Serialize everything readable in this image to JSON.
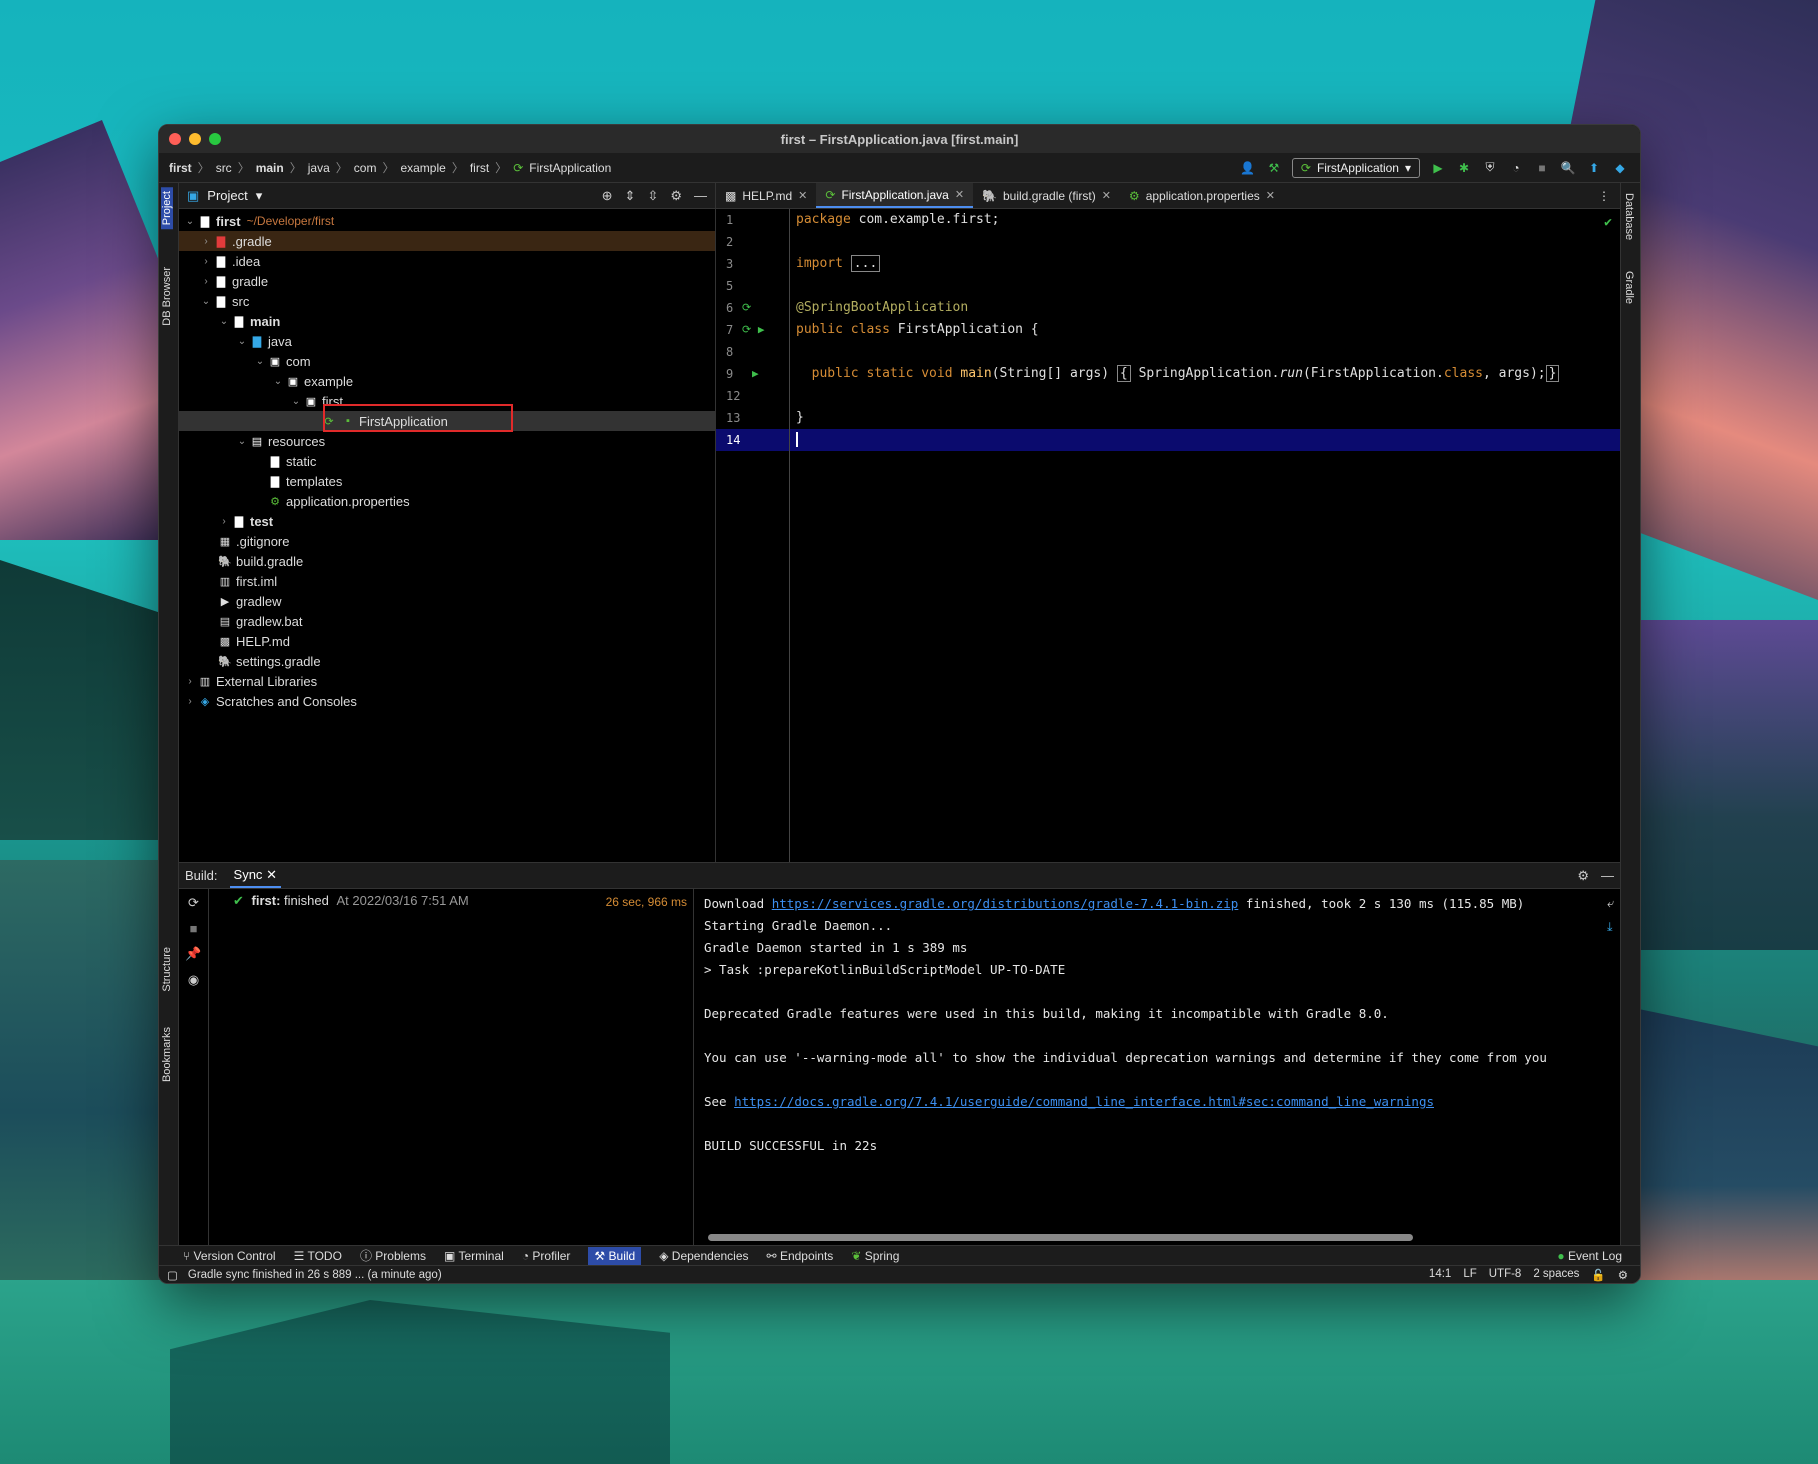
{
  "window": {
    "title": "first – FirstApplication.java [first.main]"
  },
  "breadcrumbs": [
    "first",
    "src",
    "main",
    "java",
    "com",
    "example",
    "first",
    "FirstApplication"
  ],
  "run_config": {
    "label": "FirstApplication"
  },
  "left_bar": {
    "project": "Project",
    "db_browser": "DB Browser",
    "structure": "Structure",
    "bookmarks": "Bookmarks"
  },
  "right_bar": {
    "database": "Database",
    "gradle": "Gradle"
  },
  "project_panel": {
    "title": "Project",
    "tree": [
      {
        "label": "first",
        "extra": "~/Developer/first"
      },
      {
        "label": ".gradle"
      },
      {
        "label": ".idea"
      },
      {
        "label": "gradle"
      },
      {
        "label": "src"
      },
      {
        "label": "main"
      },
      {
        "label": "java"
      },
      {
        "label": "com"
      },
      {
        "label": "example"
      },
      {
        "label": "first"
      },
      {
        "label": "FirstApplication"
      },
      {
        "label": "resources"
      },
      {
        "label": "static"
      },
      {
        "label": "templates"
      },
      {
        "label": "application.properties"
      },
      {
        "label": "test"
      },
      {
        "label": ".gitignore"
      },
      {
        "label": "build.gradle"
      },
      {
        "label": "first.iml"
      },
      {
        "label": "gradlew"
      },
      {
        "label": "gradlew.bat"
      },
      {
        "label": "HELP.md"
      },
      {
        "label": "settings.gradle"
      },
      {
        "label": "External Libraries"
      },
      {
        "label": "Scratches and Consoles"
      }
    ]
  },
  "editor": {
    "tabs": [
      "HELP.md",
      "FirstApplication.java",
      "build.gradle (first)",
      "application.properties"
    ],
    "line_numbers": [
      "1",
      "2",
      "3",
      "5",
      "6",
      "7",
      "8",
      "9",
      "12",
      "13",
      "14"
    ],
    "code": {
      "l1_kw": "package",
      "l1_rest": " com.example.first;",
      "l3_kw": "import",
      "l3_fold": "...",
      "l6_ann": "@SpringBootApplication",
      "l7_kw": "public class",
      "l7_rest": " FirstApplication {",
      "l9_kw": "public static void",
      "l9_fn": "main",
      "l9_args": "(String[] args)",
      "l9_call": "SpringApplication.",
      "l9_run": "run",
      "l9_cls": "(FirstApplication.",
      "l9_class_kw": "class",
      "l9_end": ", args);",
      "l13": "}"
    }
  },
  "build_panel": {
    "label": "Build:",
    "tab": "Sync",
    "tree_item": {
      "name": "first:",
      "status": "finished",
      "when": "At 2022/03/16 7:51 AM",
      "duration": "26 sec, 966 ms"
    },
    "console": {
      "download_prefix": "Download ",
      "download_url": "https://services.gradle.org/distributions/gradle-7.4.1-bin.zip",
      "download_suffix": " finished, took 2 s 130 ms (115.85 MB)",
      "line2": "Starting Gradle Daemon...",
      "line3": "Gradle Daemon started in 1 s 389 ms",
      "line4": "> Task :prepareKotlinBuildScriptModel UP-TO-DATE",
      "line6": "Deprecated Gradle features were used in this build, making it incompatible with Gradle 8.0.",
      "line8": "You can use '--warning-mode all' to show the individual deprecation warnings and determine if they come from you",
      "see_prefix": "See ",
      "see_url": "https://docs.gradle.org/7.4.1/userguide/command_line_interface.html#sec:command_line_warnings",
      "line12": "BUILD SUCCESSFUL in 22s"
    }
  },
  "tool_windows": [
    "Version Control",
    "TODO",
    "Problems",
    "Terminal",
    "Profiler",
    "Build",
    "Dependencies",
    "Endpoints",
    "Spring"
  ],
  "event_log": "Event Log",
  "status_bar": {
    "message": "Gradle sync finished in 26 s 889 ... (a minute ago)",
    "position": "14:1",
    "line_sep": "LF",
    "encoding": "UTF-8",
    "indent": "2 spaces"
  }
}
